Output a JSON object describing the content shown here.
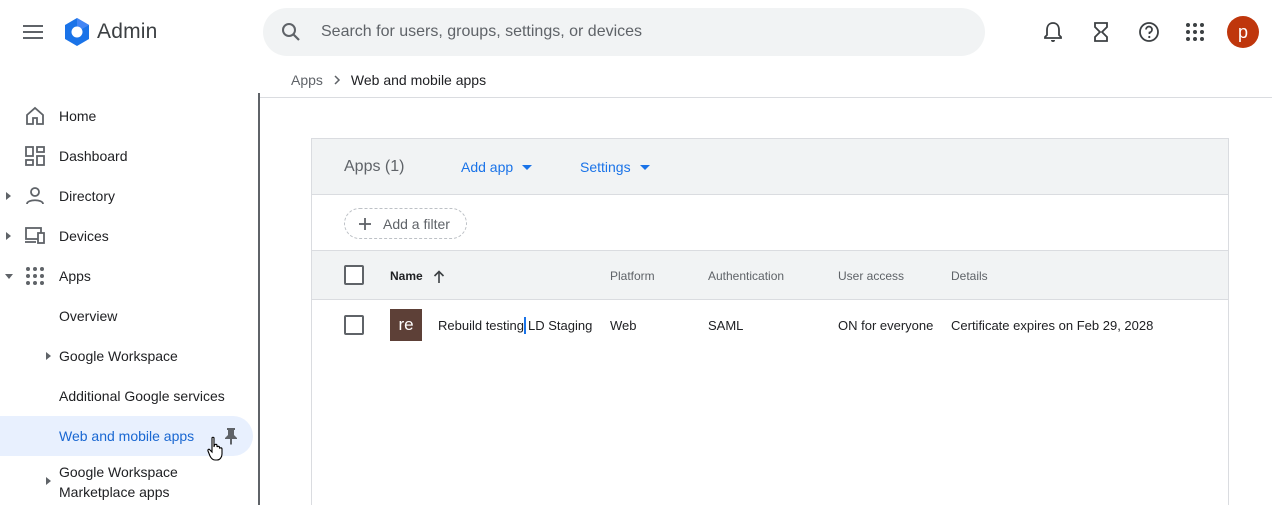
{
  "header": {
    "brand": "Admin",
    "search_placeholder": "Search for users, groups, settings, or devices",
    "avatar_letter": "p"
  },
  "breadcrumb": {
    "parent": "Apps",
    "separator": ">",
    "current": "Web and mobile apps"
  },
  "sidebar": {
    "items": [
      {
        "label": "Home"
      },
      {
        "label": "Dashboard"
      },
      {
        "label": "Directory"
      },
      {
        "label": "Devices"
      },
      {
        "label": "Apps"
      },
      {
        "label": "Overview"
      },
      {
        "label": "Google Workspace"
      },
      {
        "label": "Additional Google services"
      },
      {
        "label": "Web and mobile apps"
      },
      {
        "label": "Google Workspace",
        "label2": "Marketplace apps"
      }
    ]
  },
  "card": {
    "title": "Apps (1)",
    "add_app": "Add app",
    "settings": "Settings",
    "add_filter": "Add a filter",
    "columns": [
      "Name",
      "Platform",
      "Authentication",
      "User access",
      "Details"
    ],
    "rows": [
      {
        "avatar": "re",
        "name_part1": "Rebuild testing",
        "name_part2": "LD Staging",
        "platform": "Web",
        "authentication": "SAML",
        "user_access": "ON for everyone",
        "details": "Certificate expires on Feb 29, 2028"
      }
    ]
  },
  "colors": {
    "accent": "#1a73e8",
    "avatar_bg": "#bf360c",
    "app_avatar_bg": "#5d4037",
    "active_nav_bg": "#e8f0fe"
  }
}
